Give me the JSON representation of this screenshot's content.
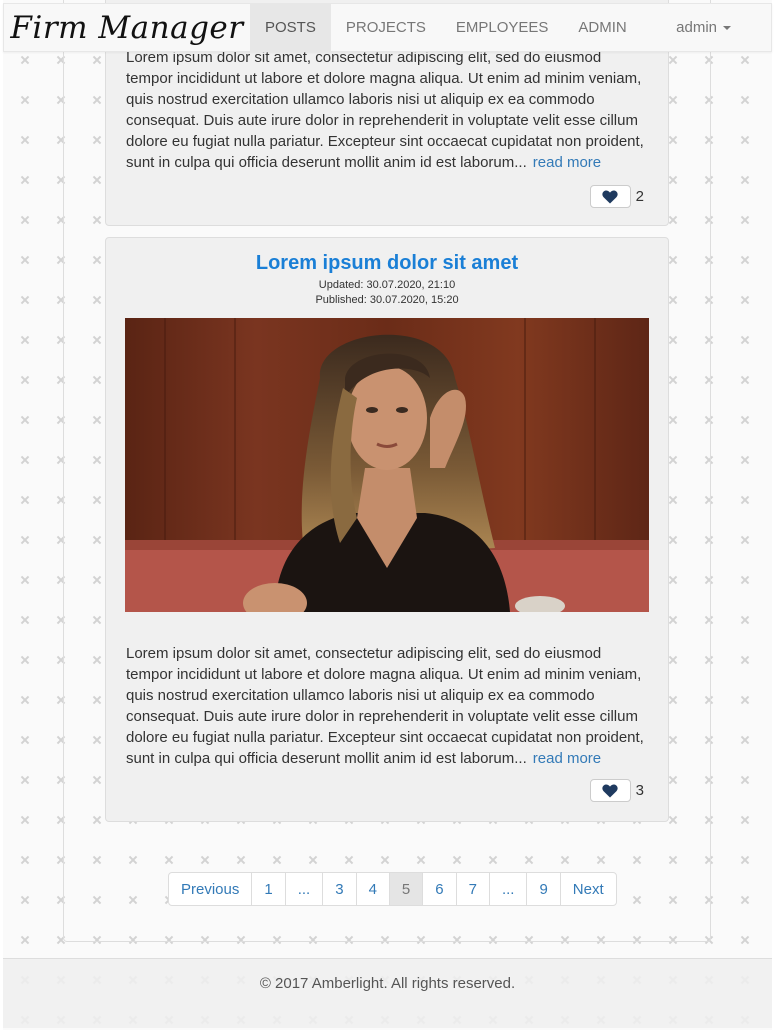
{
  "navbar": {
    "brand": "Firm Manager",
    "items": [
      {
        "label": "POSTS",
        "active": true
      },
      {
        "label": "PROJECTS",
        "active": false
      },
      {
        "label": "EMPLOYEES",
        "active": false
      },
      {
        "label": "ADMIN",
        "active": false
      }
    ],
    "user": "admin"
  },
  "posts": [
    {
      "excerpt": "Lorem ipsum dolor sit amet, consectetur adipiscing elit, sed do eiusmod tempor incididunt ut labore et dolore magna aliqua. Ut enim ad minim veniam, quis nostrud exercitation ullamco laboris nisi ut aliquip ex ea commodo consequat. Duis aute irure dolor in reprehenderit in voluptate velit esse cillum dolore eu fugiat nulla pariatur. Excepteur sint occaecat cupidatat non proident, sunt in culpa qui officia deserunt mollit anim id est laborum...",
      "read_more": "read more",
      "likes": "2"
    },
    {
      "title": "Lorem ipsum dolor sit amet",
      "updated": "Updated: 30.07.2020, 21:10",
      "published": "Published: 30.07.2020, 15:20",
      "excerpt": "Lorem ipsum dolor sit amet, consectetur adipiscing elit, sed do eiusmod tempor incididunt ut labore et dolore magna aliqua. Ut enim ad minim veniam, quis nostrud exercitation ullamco laboris nisi ut aliquip ex ea commodo consequat. Duis aute irure dolor in reprehenderit in voluptate velit esse cillum dolore eu fugiat nulla pariatur. Excepteur sint occaecat cupidatat non proident, sunt in culpa qui officia deserunt mollit anim id est laborum...",
      "read_more": "read more",
      "likes": "3"
    }
  ],
  "pagination": {
    "items": [
      "Previous",
      "1",
      "...",
      "3",
      "4",
      "5",
      "6",
      "7",
      "...",
      "9",
      "Next"
    ],
    "active": "5"
  },
  "footer": "© 2017 Amberlight. All rights reserved.",
  "colors": {
    "link": "#337ab7",
    "title": "#1a7fd6",
    "heart": "#1f3a5f"
  }
}
